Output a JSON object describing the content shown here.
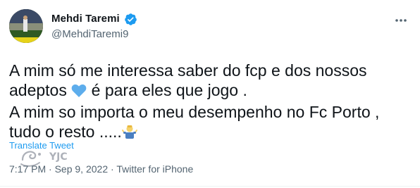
{
  "author": {
    "display_name": "Mehdi Taremi",
    "handle": "@MehdiTaremi9",
    "verified": true,
    "avatar_icon": "profile-photo"
  },
  "tweet": {
    "line1": "A mim só me interessa saber do fcp e dos nossos",
    "line2_before": "adeptos ",
    "line2_after": " é para eles que jogo .",
    "line3": "A mim so  importa o meu desempenho no  Fc Porto ,",
    "line4": "tudo o resto .....",
    "emoji_heart": "blue-heart",
    "emoji_person": "person-shrugging"
  },
  "translate_label": "Translate Tweet",
  "meta": {
    "time": "7:17 PM",
    "sep1": " · ",
    "date": "Sep 9, 2022",
    "sep2": " · ",
    "client": "Twitter for iPhone"
  },
  "watermark_text": "YJC",
  "colors": {
    "link": "#1d9bf0",
    "muted": "#536471",
    "verified": "#1d9bf0",
    "heart": "#5dadec"
  }
}
